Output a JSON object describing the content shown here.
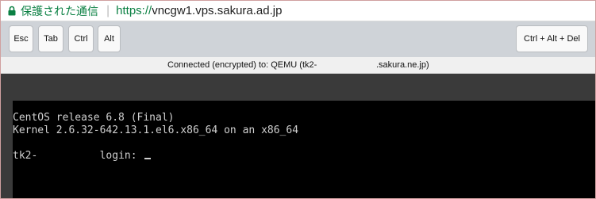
{
  "browser": {
    "secure_label": "保護された通信",
    "url_scheme": "https://",
    "url_host": "vncgw1.vps.sakura.ad.jp"
  },
  "toolbar": {
    "esc": "Esc",
    "tab": "Tab",
    "ctrl": "Ctrl",
    "alt": "Alt",
    "cad": "Ctrl + Alt + Del"
  },
  "status": {
    "connected": "Connected (encrypted) to: QEMU (tk2-",
    "domain": ".sakura.ne.jp)"
  },
  "console": {
    "line1": "CentOS release 6.8 (Final)",
    "line2": "Kernel 2.6.32-642.13.1.el6.x86_64 on an x86_64",
    "host": "tk2-",
    "login": "login:"
  },
  "colors": {
    "secure_green": "#0b8043",
    "console_bg": "#000000",
    "console_text": "#d0d0d0"
  },
  "icons": [
    "lock-icon",
    "text-cursor"
  ]
}
